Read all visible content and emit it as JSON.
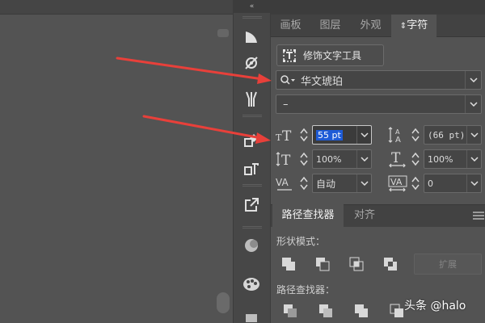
{
  "panel": {
    "collapse_glyph": "«",
    "tabs": [
      {
        "label": "画板",
        "active": false
      },
      {
        "label": "图层",
        "active": false
      },
      {
        "label": "外观",
        "active": false
      },
      {
        "label": "字符",
        "active": true,
        "prefix": "⇕"
      }
    ],
    "touch_type_tool": "修饰文字工具",
    "font_family": "华文琥珀",
    "font_style": "–",
    "font_size": "55 pt",
    "leading": "(66 pt)",
    "vertical_scale": "100%",
    "horizontal_scale": "100%",
    "kerning": "自动",
    "tracking": "0"
  },
  "pathfinder": {
    "tabs": [
      {
        "label": "路径查找器",
        "active": true
      },
      {
        "label": "对齐",
        "active": false
      }
    ],
    "shape_modes_label": "形状模式：",
    "expand_label": "扩展",
    "pathfinders_label": "路径查找器："
  },
  "tool_icons": [
    "vertex-icon",
    "shape-builder-icon",
    "brush-plus-icon",
    "symbols-icon",
    "type-styles-icon",
    "export-icon",
    "circles-icon",
    "palette-icon"
  ],
  "watermark": "头条 @halo",
  "colors": {
    "panel_bg": "#535353",
    "tab_bg": "#424242",
    "selection": "#1e5bd6",
    "arrow": "#e8403a"
  }
}
